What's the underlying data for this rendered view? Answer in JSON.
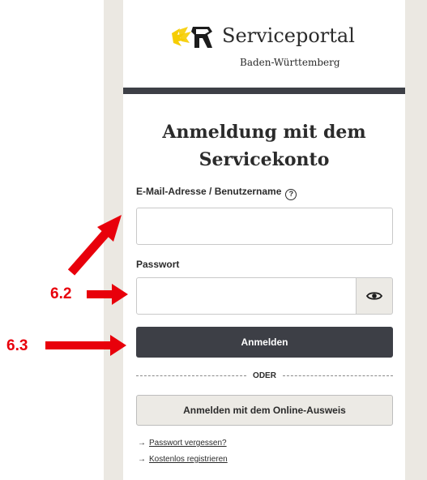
{
  "brand": {
    "name": "Serviceportal",
    "subtitle": "Baden-Württemberg",
    "logo_colors": {
      "gold": "#f6cd00",
      "dark": "#1c1c1c"
    }
  },
  "login": {
    "title_line1": "Anmeldung mit dem",
    "title_line2": "Servicekonto",
    "email_label": "E-Mail-Adresse / Benutzername",
    "help_icon_glyph": "?",
    "email_value": "",
    "password_label": "Passwort",
    "password_value": "",
    "show_password_icon": "eye-icon",
    "submit_label": "Anmelden",
    "divider_label": "ODER",
    "eid_button_label": "Anmelden mit dem Online-Ausweis",
    "links": [
      {
        "arrow": "→",
        "label": "Passwort vergessen?"
      },
      {
        "arrow": "→",
        "label": "Kostenlos registrieren"
      }
    ]
  },
  "annotations": {
    "color": "#e8000b",
    "label_password": "6.2",
    "label_submit": "6.3"
  },
  "colors": {
    "page_side": "#ebe8e2",
    "header_bar": "#3d3f46",
    "primary_button": "#3d3f46",
    "secondary_button": "#eceae5"
  }
}
